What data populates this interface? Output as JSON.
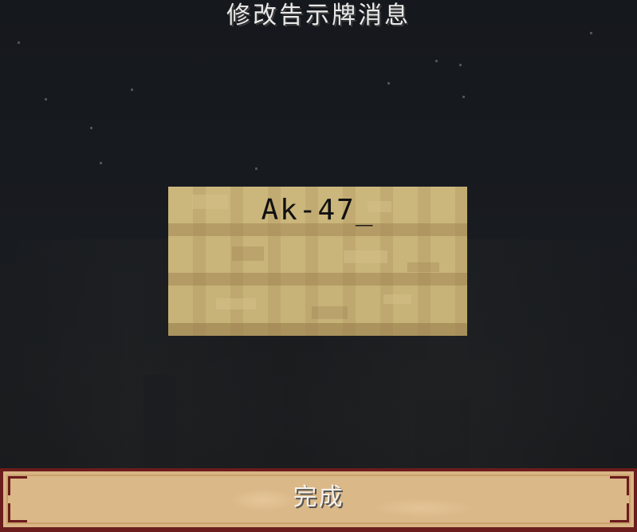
{
  "screen": {
    "title": "修改告示牌消息"
  },
  "sign": {
    "lines": [
      "Ak-47_",
      "",
      "",
      ""
    ]
  },
  "done_button": {
    "label": "完成"
  },
  "colors": {
    "background": "#15181d",
    "sign_wood": "#c9b47a",
    "button_fill": "#dbb888",
    "button_border": "#6b1c1c",
    "title_text": "#e9e9e9"
  }
}
